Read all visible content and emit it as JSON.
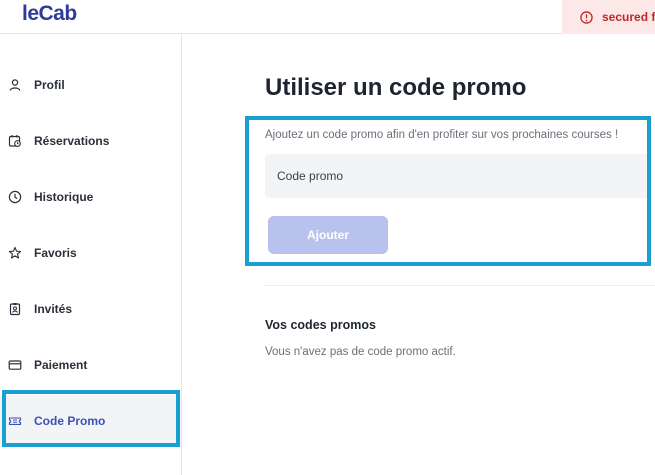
{
  "header": {
    "logo": "leCab",
    "alert_text": "secured f"
  },
  "sidebar": {
    "items": [
      {
        "label": "Profil",
        "icon": "user-icon"
      },
      {
        "label": "Réservations",
        "icon": "calendar-clock-icon"
      },
      {
        "label": "Historique",
        "icon": "clock-icon"
      },
      {
        "label": "Favoris",
        "icon": "star-icon"
      },
      {
        "label": "Invités",
        "icon": "badge-icon"
      },
      {
        "label": "Paiement",
        "icon": "credit-card-icon"
      },
      {
        "label": "Code Promo",
        "icon": "ticket-icon",
        "active": true
      }
    ]
  },
  "main": {
    "title": "Utiliser un code promo",
    "description": "Ajoutez un code promo afin d'en profiter sur vos prochaines courses !",
    "input_placeholder": "Code promo",
    "add_button_label": "Ajouter",
    "codes_section_title": "Vos codes promos",
    "codes_empty_text": "Vous n'avez pas de code promo actif."
  },
  "colors": {
    "brand": "#2f3c96",
    "active_nav": "#3a52b8",
    "highlight_outline": "#1aa0d0",
    "button_disabled": "#b9c2ec",
    "alert_bg": "#fde8e8",
    "alert_text": "#c02828"
  }
}
